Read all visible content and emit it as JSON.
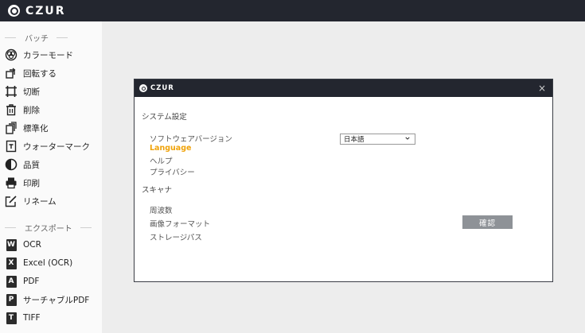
{
  "app": {
    "logo_text": "CZUR"
  },
  "sidebar": {
    "batch_title": "バッチ",
    "batch_items": [
      {
        "label": "カラーモード",
        "icon": "color-palette-icon"
      },
      {
        "label": "回転する",
        "icon": "rotate-icon"
      },
      {
        "label": "切断",
        "icon": "crop-icon"
      },
      {
        "label": "削除",
        "icon": "trash-icon"
      },
      {
        "label": "標準化",
        "icon": "standardize-icon"
      },
      {
        "label": "ウォーターマーク",
        "icon": "watermark-icon"
      },
      {
        "label": "品質",
        "icon": "quality-icon"
      },
      {
        "label": "印刷",
        "icon": "printer-icon"
      },
      {
        "label": "リネーム",
        "icon": "rename-icon"
      }
    ],
    "export_title": "エクスポート",
    "export_items": [
      {
        "label": "OCR",
        "badge": "W",
        "icon": "word-icon"
      },
      {
        "label": "Excel (OCR)",
        "badge": "X",
        "icon": "excel-icon"
      },
      {
        "label": "PDF",
        "badge": "A",
        "icon": "pdf-icon"
      },
      {
        "label": "サーチャブルPDF",
        "badge": "P",
        "icon": "searchable-pdf-icon"
      },
      {
        "label": "TIFF",
        "badge": "T",
        "icon": "tiff-icon"
      }
    ]
  },
  "dialog": {
    "logo_text": "CZUR",
    "close_symbol": "×",
    "system_settings_title": "システム設定",
    "software_version_label": "ソフトウェアバージョン",
    "language_label": "Language",
    "help_label": "ヘルプ",
    "privacy_label": "プライバシー",
    "scanner_title": "スキャナ",
    "frequency_label": "周波数",
    "image_format_label": "画像フォーマット",
    "storage_path_label": "ストレージパス",
    "language_value": "日本語",
    "confirm_label": "確認"
  },
  "colors": {
    "topbar": "#23262f",
    "accent": "#f0a30a",
    "button": "#8e9297"
  }
}
